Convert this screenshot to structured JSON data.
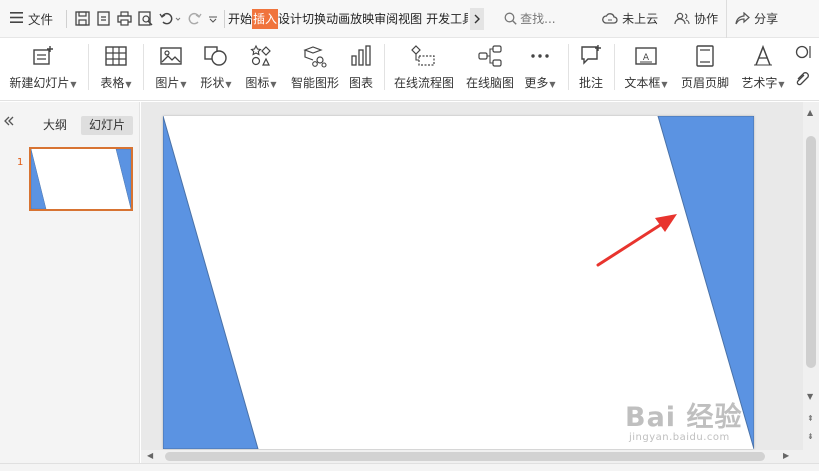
{
  "menubar": {
    "file_label": "文件",
    "tabs": [
      {
        "label": "开始",
        "active": false
      },
      {
        "label": "插入",
        "active": true
      },
      {
        "label": "设计",
        "active": false
      },
      {
        "label": "切换",
        "active": false
      },
      {
        "label": "动画",
        "active": false
      },
      {
        "label": "放映",
        "active": false
      },
      {
        "label": "审阅",
        "active": false
      },
      {
        "label": "视图",
        "active": false
      },
      {
        "label": "开发工具",
        "active": false
      }
    ],
    "search_label": "查找...",
    "cloud_label": "未上云",
    "collab_label": "协作",
    "share_label": "分享"
  },
  "ribbon": {
    "items": [
      {
        "label": "新建幻灯片",
        "icon": "new-slide-icon",
        "dropdown": true
      },
      {
        "label": "表格",
        "icon": "table-icon",
        "dropdown": true
      },
      {
        "label": "图片",
        "icon": "picture-icon",
        "dropdown": true
      },
      {
        "label": "形状",
        "icon": "shapes-icon",
        "dropdown": true
      },
      {
        "label": "图标",
        "icon": "icon-library-icon",
        "dropdown": true
      },
      {
        "label": "智能图形",
        "icon": "smart-graphic-icon",
        "dropdown": false
      },
      {
        "label": "图表",
        "icon": "chart-icon",
        "dropdown": false
      },
      {
        "label": "在线流程图",
        "icon": "flowchart-icon",
        "dropdown": false
      },
      {
        "label": "在线脑图",
        "icon": "mindmap-icon",
        "dropdown": false
      },
      {
        "label": "更多",
        "icon": "more-icon",
        "dropdown": true
      },
      {
        "label": "批注",
        "icon": "comment-icon",
        "dropdown": false
      },
      {
        "label": "文本框",
        "icon": "textbox-icon",
        "dropdown": true
      },
      {
        "label": "页眉页脚",
        "icon": "header-footer-icon",
        "dropdown": false
      },
      {
        "label": "艺术字",
        "icon": "wordart-icon",
        "dropdown": true
      }
    ]
  },
  "leftpane": {
    "tab_outline": "大纲",
    "tab_slides": "幻灯片",
    "slide_number": "1"
  },
  "colors": {
    "accent": "#f0743c",
    "shape_fill": "#5b93e2",
    "shape_stroke": "#4a72a8",
    "arrow": "#e8342e",
    "thumb_border": "#d77332"
  },
  "watermark": {
    "main": "Bai 经验",
    "sub": "jingyan.baidu.com"
  }
}
